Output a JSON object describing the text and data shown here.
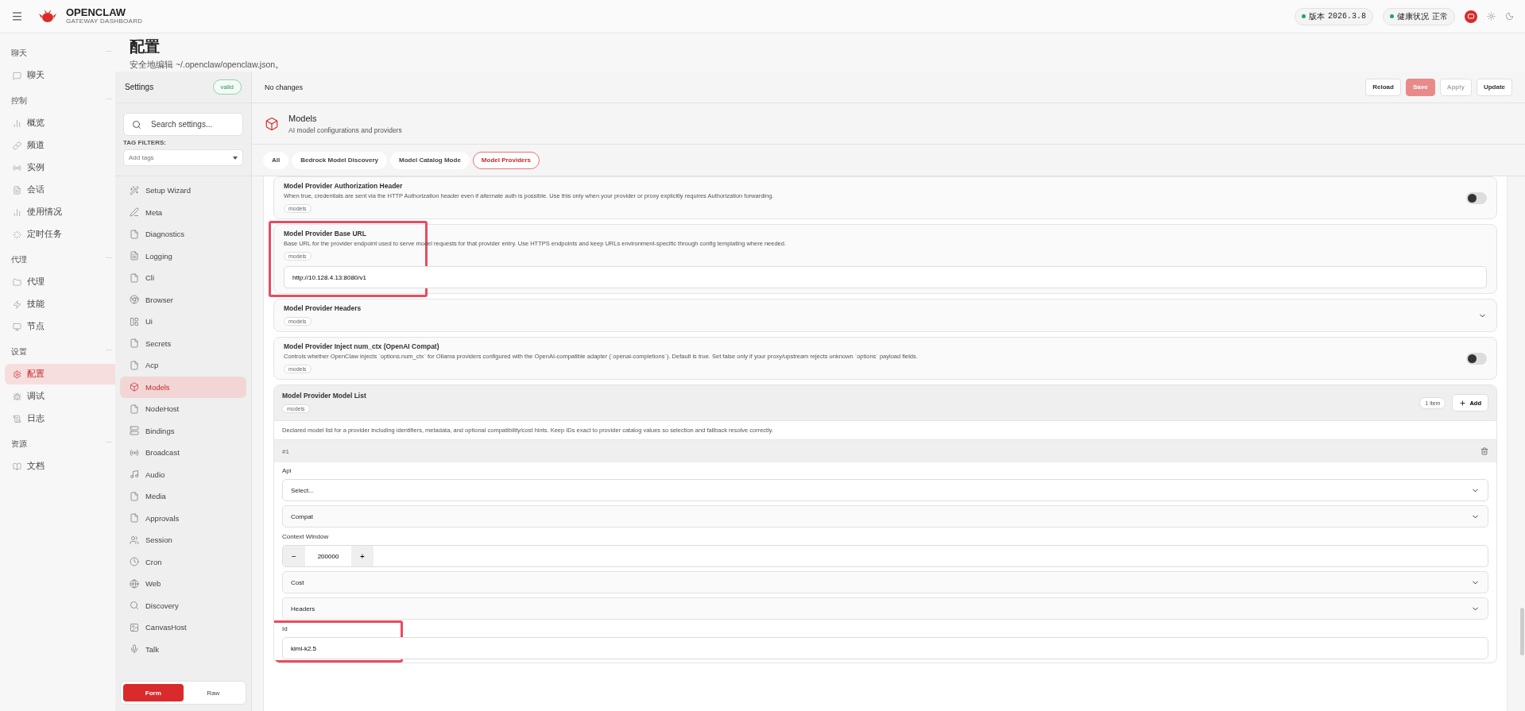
{
  "brand": {
    "title": "OPENCLAW",
    "subtitle": "GATEWAY DASHBOARD"
  },
  "status_pills": [
    {
      "label": "版本",
      "value": "2026.3.8",
      "color": "#22a55a"
    },
    {
      "label": "健康状况",
      "value": "正常",
      "color": "#22a55a"
    }
  ],
  "nav_groups": [
    {
      "title": "聊天",
      "items": [
        {
          "label": "聊天",
          "selected": false
        }
      ]
    },
    {
      "title": "控制",
      "items": [
        {
          "label": "概览",
          "selected": false
        },
        {
          "label": "频道",
          "selected": false
        },
        {
          "label": "实例",
          "selected": false
        },
        {
          "label": "会话",
          "selected": false
        },
        {
          "label": "使用情况",
          "selected": false
        },
        {
          "label": "定时任务",
          "selected": false
        }
      ]
    },
    {
      "title": "代理",
      "items": [
        {
          "label": "代理",
          "selected": false
        },
        {
          "label": "技能",
          "selected": false
        },
        {
          "label": "节点",
          "selected": false
        }
      ]
    },
    {
      "title": "设置",
      "items": [
        {
          "label": "配置",
          "selected": true
        },
        {
          "label": "调试",
          "selected": false
        },
        {
          "label": "日志",
          "selected": false
        }
      ]
    },
    {
      "title": "资源",
      "items": [
        {
          "label": "文档",
          "selected": false
        }
      ]
    }
  ],
  "page": {
    "title": "配置",
    "subtitle": "安全地编辑 ~/.openclaw/openclaw.json。"
  },
  "settings": {
    "title": "Settings",
    "badge": "valid",
    "search_placeholder": "Search settings...",
    "tag_filters_label": "TAG FILTERS:",
    "tags_placeholder": "Add tags",
    "items": [
      {
        "label": "Setup Wizard",
        "selected": false
      },
      {
        "label": "Meta",
        "selected": false
      },
      {
        "label": "Diagnostics",
        "selected": false
      },
      {
        "label": "Logging",
        "selected": false
      },
      {
        "label": "Cli",
        "selected": false
      },
      {
        "label": "Browser",
        "selected": false
      },
      {
        "label": "Ui",
        "selected": false
      },
      {
        "label": "Secrets",
        "selected": false
      },
      {
        "label": "Acp",
        "selected": false
      },
      {
        "label": "Models",
        "selected": true
      },
      {
        "label": "NodeHost",
        "selected": false
      },
      {
        "label": "Bindings",
        "selected": false
      },
      {
        "label": "Broadcast",
        "selected": false
      },
      {
        "label": "Audio",
        "selected": false
      },
      {
        "label": "Media",
        "selected": false
      },
      {
        "label": "Approvals",
        "selected": false
      },
      {
        "label": "Session",
        "selected": false
      },
      {
        "label": "Cron",
        "selected": false
      },
      {
        "label": "Web",
        "selected": false
      },
      {
        "label": "Discovery",
        "selected": false
      },
      {
        "label": "CanvasHost",
        "selected": false
      },
      {
        "label": "Talk",
        "selected": false
      }
    ],
    "modes": [
      {
        "label": "Form",
        "selected": true
      },
      {
        "label": "Raw",
        "selected": false
      }
    ]
  },
  "toolbar": {
    "status": "No changes",
    "buttons": [
      {
        "label": "Reload",
        "kind": "plain",
        "disabled": false
      },
      {
        "label": "Save",
        "kind": "primary",
        "disabled": true
      },
      {
        "label": "Apply",
        "kind": "plain",
        "disabled": true
      },
      {
        "label": "Update",
        "kind": "plain",
        "disabled": false
      }
    ]
  },
  "section": {
    "title": "Models",
    "subtitle": "AI model configurations and providers"
  },
  "tabs": [
    {
      "label": "All",
      "selected": false
    },
    {
      "label": "Bedrock Model Discovery",
      "selected": false
    },
    {
      "label": "Model Catalog Mode",
      "selected": false
    },
    {
      "label": "Model Providers",
      "selected": true
    }
  ],
  "fields": [
    {
      "kind": "toggle",
      "title": "Model Provider Authorization Header",
      "description": "When true, credentials are sent via the HTTP Authorization header even if alternate auth is possible. Use this only when your provider or proxy explicitly requires Authorization forwarding.",
      "tag": "models",
      "on": false,
      "highlighted": false
    },
    {
      "kind": "text",
      "title": "Model Provider Base URL",
      "description": "Base URL for the provider endpoint used to serve model requests for that provider entry. Use HTTPS endpoints and keep URLs environment-specific through config templating where needed.",
      "tag": "models",
      "value": "http://10.128.4.13:8080/v1",
      "highlighted": true
    },
    {
      "kind": "collapsible",
      "title": "Model Provider Headers",
      "tag": "models",
      "expanded": false,
      "highlighted": false
    },
    {
      "kind": "toggle",
      "title": "Model Provider Inject num_ctx (OpenAI Compat)",
      "description": "Controls whether OpenClaw injects `options.num_ctx` for Ollama providers configured with the OpenAI-compatible adapter (`openai-completions`). Default is true. Set false only if your proxy/upstream rejects unknown `options` payload fields.",
      "tag": "models",
      "on": false,
      "highlighted": false
    }
  ],
  "model_list": {
    "title": "Model Provider Model List",
    "tag": "models",
    "count": "1 item",
    "add_label": "Add",
    "description": "Declared model list for a provider including identifiers, metadata, and optional compatibility/cost hints. Keep IDs exact to provider catalog values so selection and fallback resolve correctly.",
    "entry": {
      "index": "#1",
      "fields": [
        {
          "kind": "select",
          "label": "Api",
          "placeholder": "Select...",
          "highlighted": false
        },
        {
          "kind": "collapsible",
          "title": "Compat",
          "expanded": false,
          "highlighted": false
        },
        {
          "kind": "number",
          "label": "Context Window",
          "value": "200000",
          "minus": "−",
          "plus": "+",
          "highlighted": false
        },
        {
          "kind": "collapsible",
          "title": "Cost",
          "expanded": false,
          "highlighted": false
        },
        {
          "kind": "collapsible",
          "title": "Headers",
          "expanded": false,
          "highlighted": false
        },
        {
          "kind": "text",
          "label": "Id",
          "value": "kimi-k2.5",
          "highlighted": true
        }
      ]
    }
  }
}
